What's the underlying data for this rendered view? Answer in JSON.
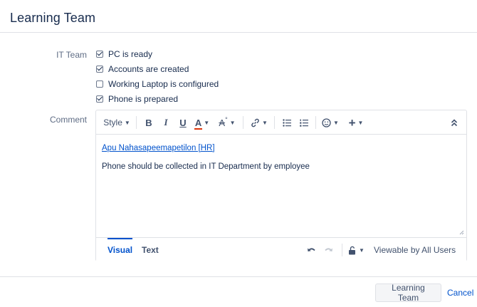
{
  "dialog": {
    "title": "Learning Team"
  },
  "it_team": {
    "label": "IT Team",
    "items": [
      {
        "label": "PC is ready",
        "checked": true
      },
      {
        "label": "Accounts are created",
        "checked": true
      },
      {
        "label": "Working Laptop is configured",
        "checked": false
      },
      {
        "label": "Phone is prepared",
        "checked": true
      }
    ]
  },
  "comment": {
    "label": "Comment",
    "toolbar": {
      "style_label": "Style",
      "icons": [
        "bold-icon",
        "italic-icon",
        "underline-icon",
        "text-color-icon",
        "text-effects-icon",
        "link-icon",
        "bullet-list-icon",
        "numbered-list-icon",
        "emoji-icon",
        "insert-plus-icon",
        "collapse-toolbar-icon"
      ],
      "text_color": "#de350b"
    },
    "mention": "Apu Nahasapeemapetilon [HR]",
    "body": "Phone should be collected in IT Department by employee",
    "tabs": {
      "visual": "Visual",
      "text": "Text"
    },
    "viewable_by": "Viewable by All Users"
  },
  "footer": {
    "submit_label": "Learning Team",
    "cancel_label": "Cancel"
  },
  "colors": {
    "link": "#0052cc",
    "text": "#172b4d",
    "muted": "#5e6c84",
    "border": "#dfe1e6"
  }
}
